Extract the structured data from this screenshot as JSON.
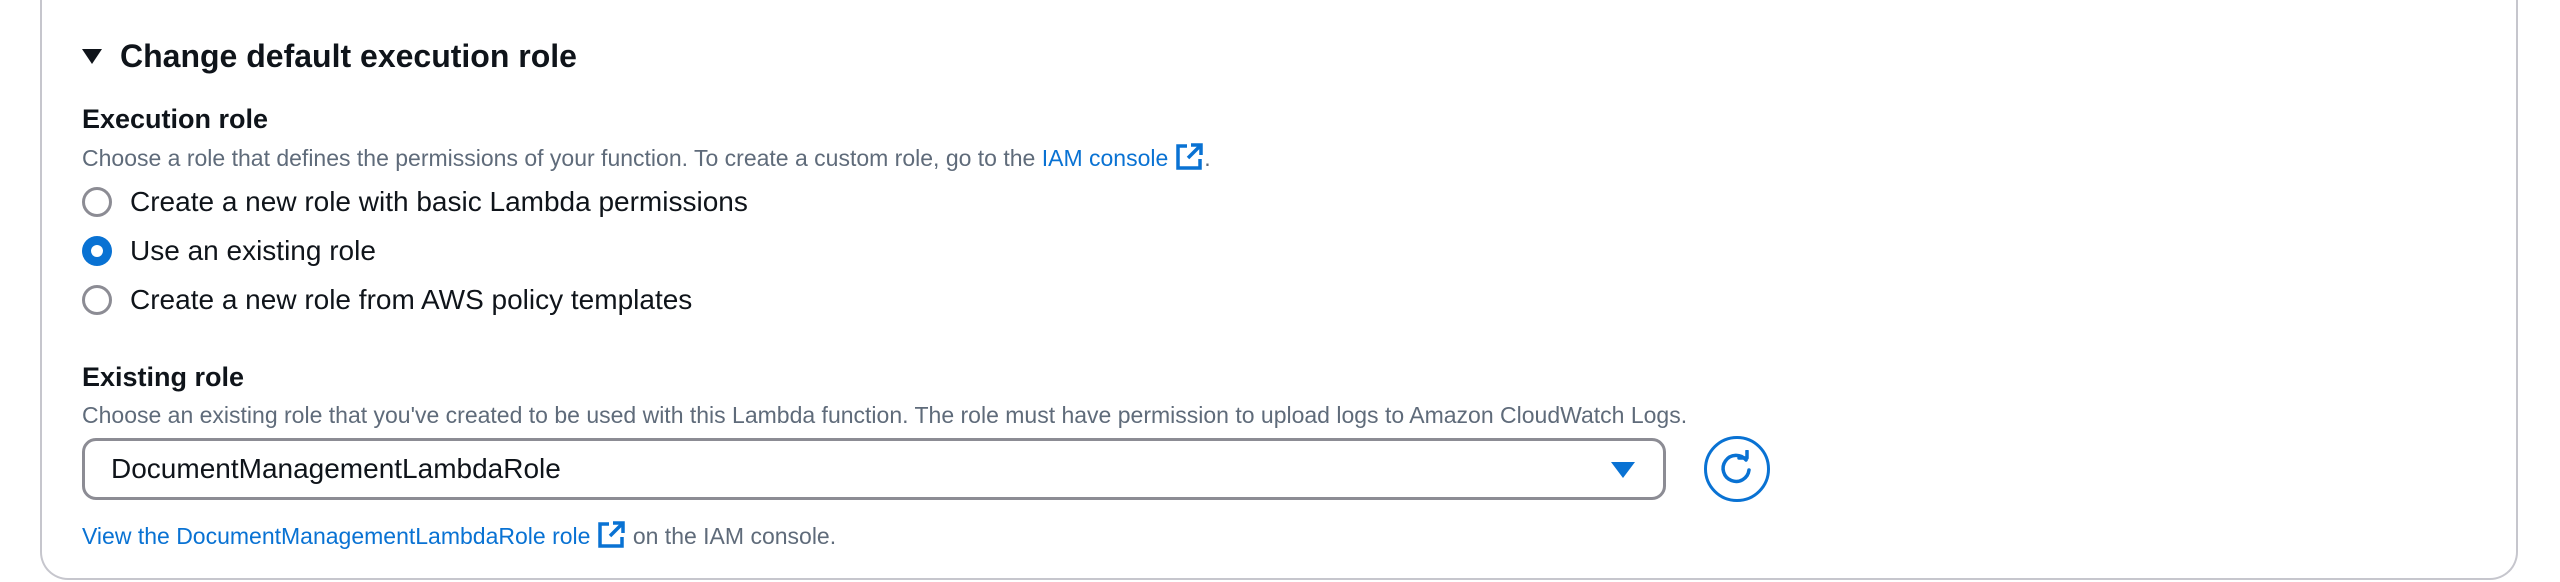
{
  "section": {
    "title": "Change default execution role",
    "expanded": true
  },
  "execution_role": {
    "label": "Execution role",
    "description_prefix": "Choose a role that defines the permissions of your function. To create a custom role, go to the ",
    "console_link": "IAM console",
    "description_suffix": ".",
    "options": [
      {
        "label": "Create a new role with basic Lambda permissions",
        "selected": false
      },
      {
        "label": "Use an existing role",
        "selected": true
      },
      {
        "label": "Create a new role from AWS policy templates",
        "selected": false
      }
    ]
  },
  "existing_role": {
    "label": "Existing role",
    "description": "Choose an existing role that you've created to be used with this Lambda function. The role must have permission to upload logs to Amazon CloudWatch Logs.",
    "selected_value": "DocumentManagementLambdaRole",
    "view_link": "View the DocumentManagementLambdaRole role",
    "view_suffix": "on the IAM console."
  },
  "icons": {
    "external": "external-link-icon",
    "refresh": "refresh-icon",
    "dropdown": "caret-down-icon",
    "section": "caret-down-icon"
  },
  "colors": {
    "accent": "#0972d3",
    "text": "#0f141a",
    "muted": "#5f6b7a",
    "border": "#8c8c94"
  }
}
